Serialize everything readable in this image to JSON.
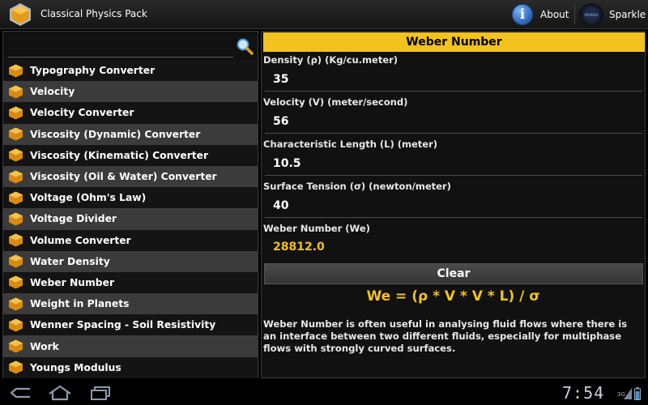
{
  "app": {
    "title": "Classical Physics Pack",
    "logo_icon": "hexagon-logo-icon"
  },
  "topbar": {
    "about_label": "About",
    "about_icon": "info-icon",
    "sparkle_label": "Sparkle",
    "sparkle_icon": "sparkle-logo-icon",
    "sparkle_logo_text": "SPARKLE"
  },
  "search": {
    "value": "",
    "placeholder": "",
    "icon": "search-icon"
  },
  "list": {
    "item_icon": "hexagon-icon",
    "items": [
      {
        "label": "Typography Converter"
      },
      {
        "label": "Velocity"
      },
      {
        "label": "Velocity Converter"
      },
      {
        "label": "Viscosity (Dynamic) Converter"
      },
      {
        "label": "Viscosity (Kinematic) Converter"
      },
      {
        "label": "Viscosity (Oil & Water) Converter"
      },
      {
        "label": "Voltage (Ohm's Law)"
      },
      {
        "label": "Voltage Divider"
      },
      {
        "label": "Volume Converter"
      },
      {
        "label": "Water Density"
      },
      {
        "label": "Weber Number"
      },
      {
        "label": "Weight in Planets"
      },
      {
        "label": "Wenner Spacing - Soil Resistivity"
      },
      {
        "label": "Work"
      },
      {
        "label": "Youngs Modulus"
      }
    ]
  },
  "calculator": {
    "title": "Weber Number",
    "fields": [
      {
        "label": "Density (ρ) (Kg/cu.meter)",
        "value": "35"
      },
      {
        "label": "Velocity (V) (meter/second)",
        "value": "56"
      },
      {
        "label": "Characteristic Length (L) (meter)",
        "value": "10.5"
      },
      {
        "label": "Surface Tension (σ) (newton/meter)",
        "value": "40"
      }
    ],
    "result_label": "Weber Number (We)",
    "result_value": "28812.0",
    "clear_label": "Clear",
    "formula": "We = (ρ * V * V * L) / σ",
    "description": "Weber Number is often useful in analysing fluid flows where there is an interface between two different fluids, especially for multiphase flows with strongly curved surfaces."
  },
  "system_bar": {
    "back_icon": "back-icon",
    "home_icon": "home-icon",
    "recent_icon": "recent-apps-icon",
    "clock": "7:54",
    "network": "3G",
    "signal_icon": "signal-icon",
    "battery_icon": "battery-icon"
  },
  "colors": {
    "accent": "#f2c21e",
    "row_alt": "#3b3b3b",
    "row_dark": "#141414"
  }
}
